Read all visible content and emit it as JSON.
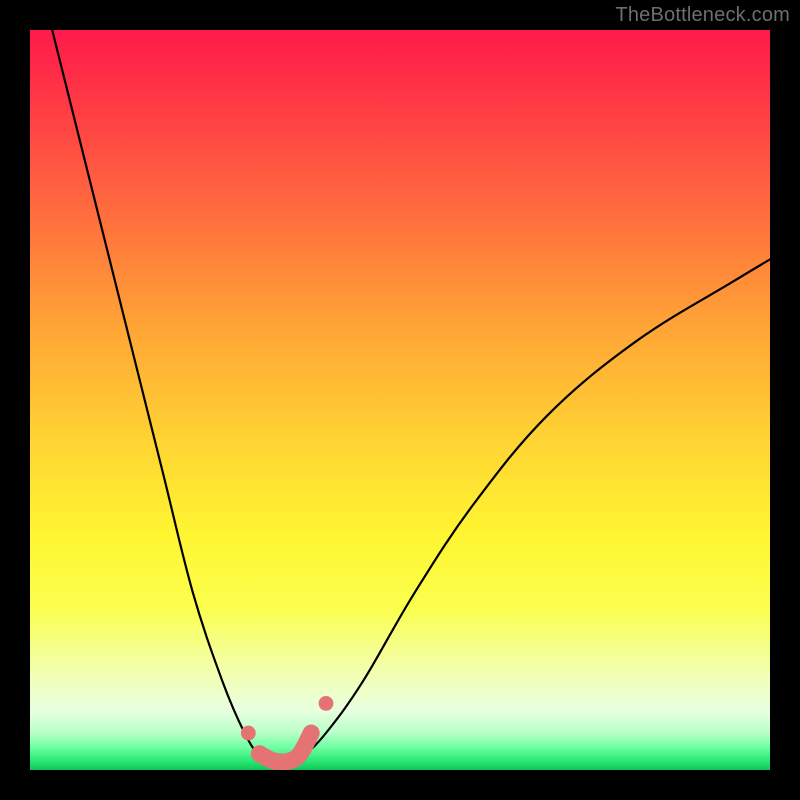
{
  "watermark": "TheBottleneck.com",
  "colors": {
    "background": "#000000",
    "curve_stroke": "#000000",
    "marker_fill": "#e57373",
    "marker_stroke": "#d86060"
  },
  "chart_data": {
    "type": "line",
    "title": "",
    "xlabel": "",
    "ylabel": "",
    "xlim": [
      0,
      100
    ],
    "ylim": [
      0,
      100
    ],
    "grid": false,
    "series": [
      {
        "name": "bottleneck-curve",
        "x": [
          3,
          6,
          10,
          14,
          18,
          22,
          26,
          29,
          31,
          33,
          35,
          37,
          40,
          45,
          52,
          60,
          70,
          82,
          95,
          100
        ],
        "y": [
          100,
          88,
          72,
          56,
          40,
          24,
          12,
          5,
          2,
          1,
          1,
          2,
          5,
          12,
          24,
          36,
          48,
          58,
          66,
          69
        ]
      }
    ],
    "markers": {
      "name": "highlight-region",
      "x": [
        29.5,
        31,
        33,
        35,
        36.5,
        38,
        40
      ],
      "y": [
        5,
        2.2,
        1.2,
        1.2,
        2.2,
        5,
        9
      ],
      "dot_r_large": 1.6,
      "dot_r_small": 1.0
    },
    "gradient_stops": [
      {
        "pos": 0.0,
        "color": "#ff1a4a"
      },
      {
        "pos": 0.1,
        "color": "#ff3a45"
      },
      {
        "pos": 0.25,
        "color": "#ff6e3e"
      },
      {
        "pos": 0.4,
        "color": "#ffa436"
      },
      {
        "pos": 0.55,
        "color": "#ffd233"
      },
      {
        "pos": 0.68,
        "color": "#fff531"
      },
      {
        "pos": 0.78,
        "color": "#fbff4d"
      },
      {
        "pos": 0.86,
        "color": "#f2ffa8"
      },
      {
        "pos": 0.92,
        "color": "#e8ffe0"
      },
      {
        "pos": 0.95,
        "color": "#b8ffc8"
      },
      {
        "pos": 0.97,
        "color": "#6cffa0"
      },
      {
        "pos": 0.99,
        "color": "#22e46e"
      },
      {
        "pos": 1.0,
        "color": "#12c458"
      }
    ]
  }
}
